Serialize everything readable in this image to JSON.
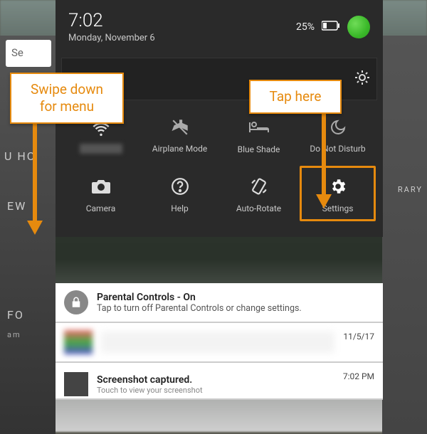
{
  "statusbar": {
    "time": "7:02",
    "date": "Monday, November 6",
    "battery_percent": "25%"
  },
  "tiles": {
    "wifi": {
      "label": ""
    },
    "airplane": {
      "label": "Airplane Mode"
    },
    "blueshade": {
      "label": "Blue Shade"
    },
    "dnd": {
      "label": "Do Not Disturb"
    },
    "camera": {
      "label": "Camera"
    },
    "help": {
      "label": "Help"
    },
    "autorotate": {
      "label": "Auto-Rotate"
    },
    "settings": {
      "label": "Settings"
    }
  },
  "notifications": [
    {
      "title": "Parental Controls - On",
      "text": "Tap to turn off Parental Controls or change settings.",
      "time": ""
    },
    {
      "title": "",
      "text": "",
      "time": "11/5/17"
    },
    {
      "title": "Screenshot captured.",
      "text": "Touch to view your screenshot",
      "time": "7:02 PM"
    }
  ],
  "callouts": {
    "swipe": "Swipe down for menu",
    "tap": "Tap here"
  },
  "background": {
    "search_text": "Se",
    "label_ew": "EW",
    "label_rary": "RARY",
    "label_u_ho": "U  HO",
    "label_fo": "FO",
    "label_am": "am"
  },
  "colors": {
    "callout_accent": "#e68a0e",
    "panel_bg": "#2a2a2a"
  }
}
